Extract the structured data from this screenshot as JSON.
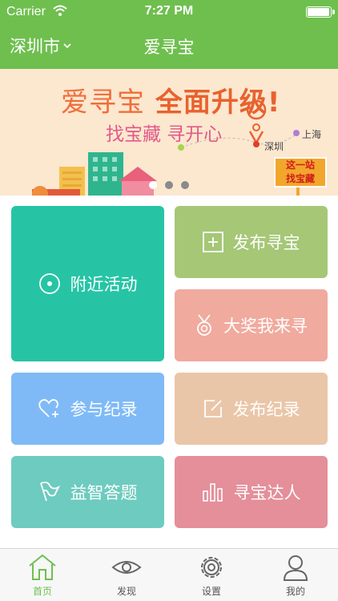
{
  "status_bar": {
    "carrier": "Carrier",
    "time": "7:27 PM"
  },
  "nav": {
    "city": "深圳市",
    "title": "爱寻宝"
  },
  "banner": {
    "headline_part1": "爱寻宝",
    "headline_part2": "全面升级!",
    "subtitle": "找宝藏 寻开心",
    "city_shenzhen": "深圳",
    "city_shanghai": "上海",
    "stamp_line1": "这一站",
    "stamp_line2": "找宝藏",
    "page_count": 3,
    "active_page": 1
  },
  "tiles": [
    {
      "id": "nearby",
      "label": "附近活动",
      "icon": "target-icon",
      "color": "#26c4a5"
    },
    {
      "id": "publish-treasure",
      "label": "发布寻宝",
      "icon": "plus-square-icon",
      "color": "#a5c776"
    },
    {
      "id": "prize",
      "label": "大奖我来寻",
      "icon": "medal-icon",
      "color": "#f0aa9e"
    },
    {
      "id": "participation",
      "label": "参与纪录",
      "icon": "heart-plus-icon",
      "color": "#7fbaf7"
    },
    {
      "id": "publish-records",
      "label": "发布纪录",
      "icon": "edit-icon",
      "color": "#eac6a8"
    },
    {
      "id": "quiz",
      "label": "益智答题",
      "icon": "flag-icon",
      "color": "#6ecbbf"
    },
    {
      "id": "ranking",
      "label": "寻宝达人",
      "icon": "bar-chart-icon",
      "color": "#e48f9a"
    }
  ],
  "tabs": [
    {
      "label": "首页",
      "icon": "home-icon",
      "active": true
    },
    {
      "label": "发现",
      "icon": "eye-icon",
      "active": false
    },
    {
      "label": "设置",
      "icon": "gear-icon",
      "active": false
    },
    {
      "label": "我的",
      "icon": "user-icon",
      "active": false
    }
  ],
  "colors": {
    "primary": "#6fbf4f",
    "banner_bg": "#fce7cf"
  }
}
